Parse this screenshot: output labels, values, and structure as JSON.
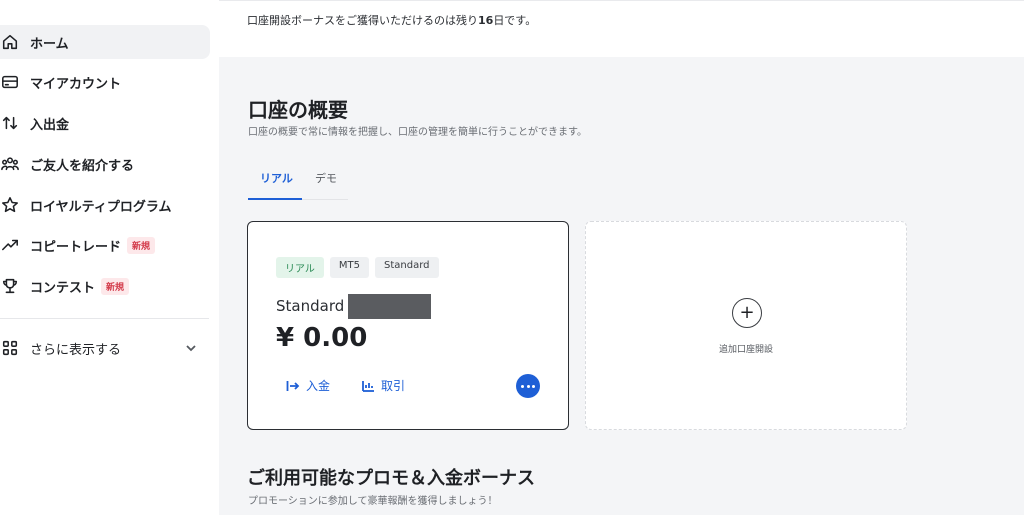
{
  "sidebar": {
    "items": [
      {
        "label": "ホーム",
        "icon": "home-icon",
        "active": true
      },
      {
        "label": "マイアカウント",
        "icon": "wallet-icon"
      },
      {
        "label": "入出金",
        "icon": "transfer-arrows-icon"
      },
      {
        "label": "ご友人を紹介する",
        "icon": "users-icon"
      },
      {
        "label": "ロイヤルティプログラム",
        "icon": "star-icon"
      },
      {
        "label": "コピートレード",
        "icon": "trend-up-icon",
        "badge": "新規"
      },
      {
        "label": "コンテスト",
        "icon": "trophy-icon",
        "badge": "新規"
      }
    ],
    "more": {
      "label": "さらに表示する",
      "icon": "grid-icon"
    }
  },
  "banner": {
    "prefix": "口座開設ボーナスをご獲得いただけるのは残り",
    "days": "16",
    "suffix": "日です。"
  },
  "overview": {
    "title": "口座の概要",
    "subtitle": "口座の概要で常に情報を把握し、口座の管理を簡単に行うことができます。",
    "tabs": [
      {
        "label": "リアル",
        "active": true
      },
      {
        "label": "デモ",
        "active": false
      }
    ]
  },
  "account_card": {
    "chips": [
      "リアル",
      "MT5",
      "Standard"
    ],
    "name": "Standard",
    "balance": "¥ 0.00",
    "deposit_label": "入金",
    "trade_label": "取引"
  },
  "add_account": {
    "label": "追加口座開設"
  },
  "promo": {
    "title": "ご利用可能なプロモ＆入金ボーナス",
    "subtitle": "プロモーションに参加して豪華報酬を獲得しましょう！"
  },
  "colors": {
    "accent": "#1e5fd6",
    "badge_red": "#d33a4a",
    "real_green": "#2a8a55"
  }
}
